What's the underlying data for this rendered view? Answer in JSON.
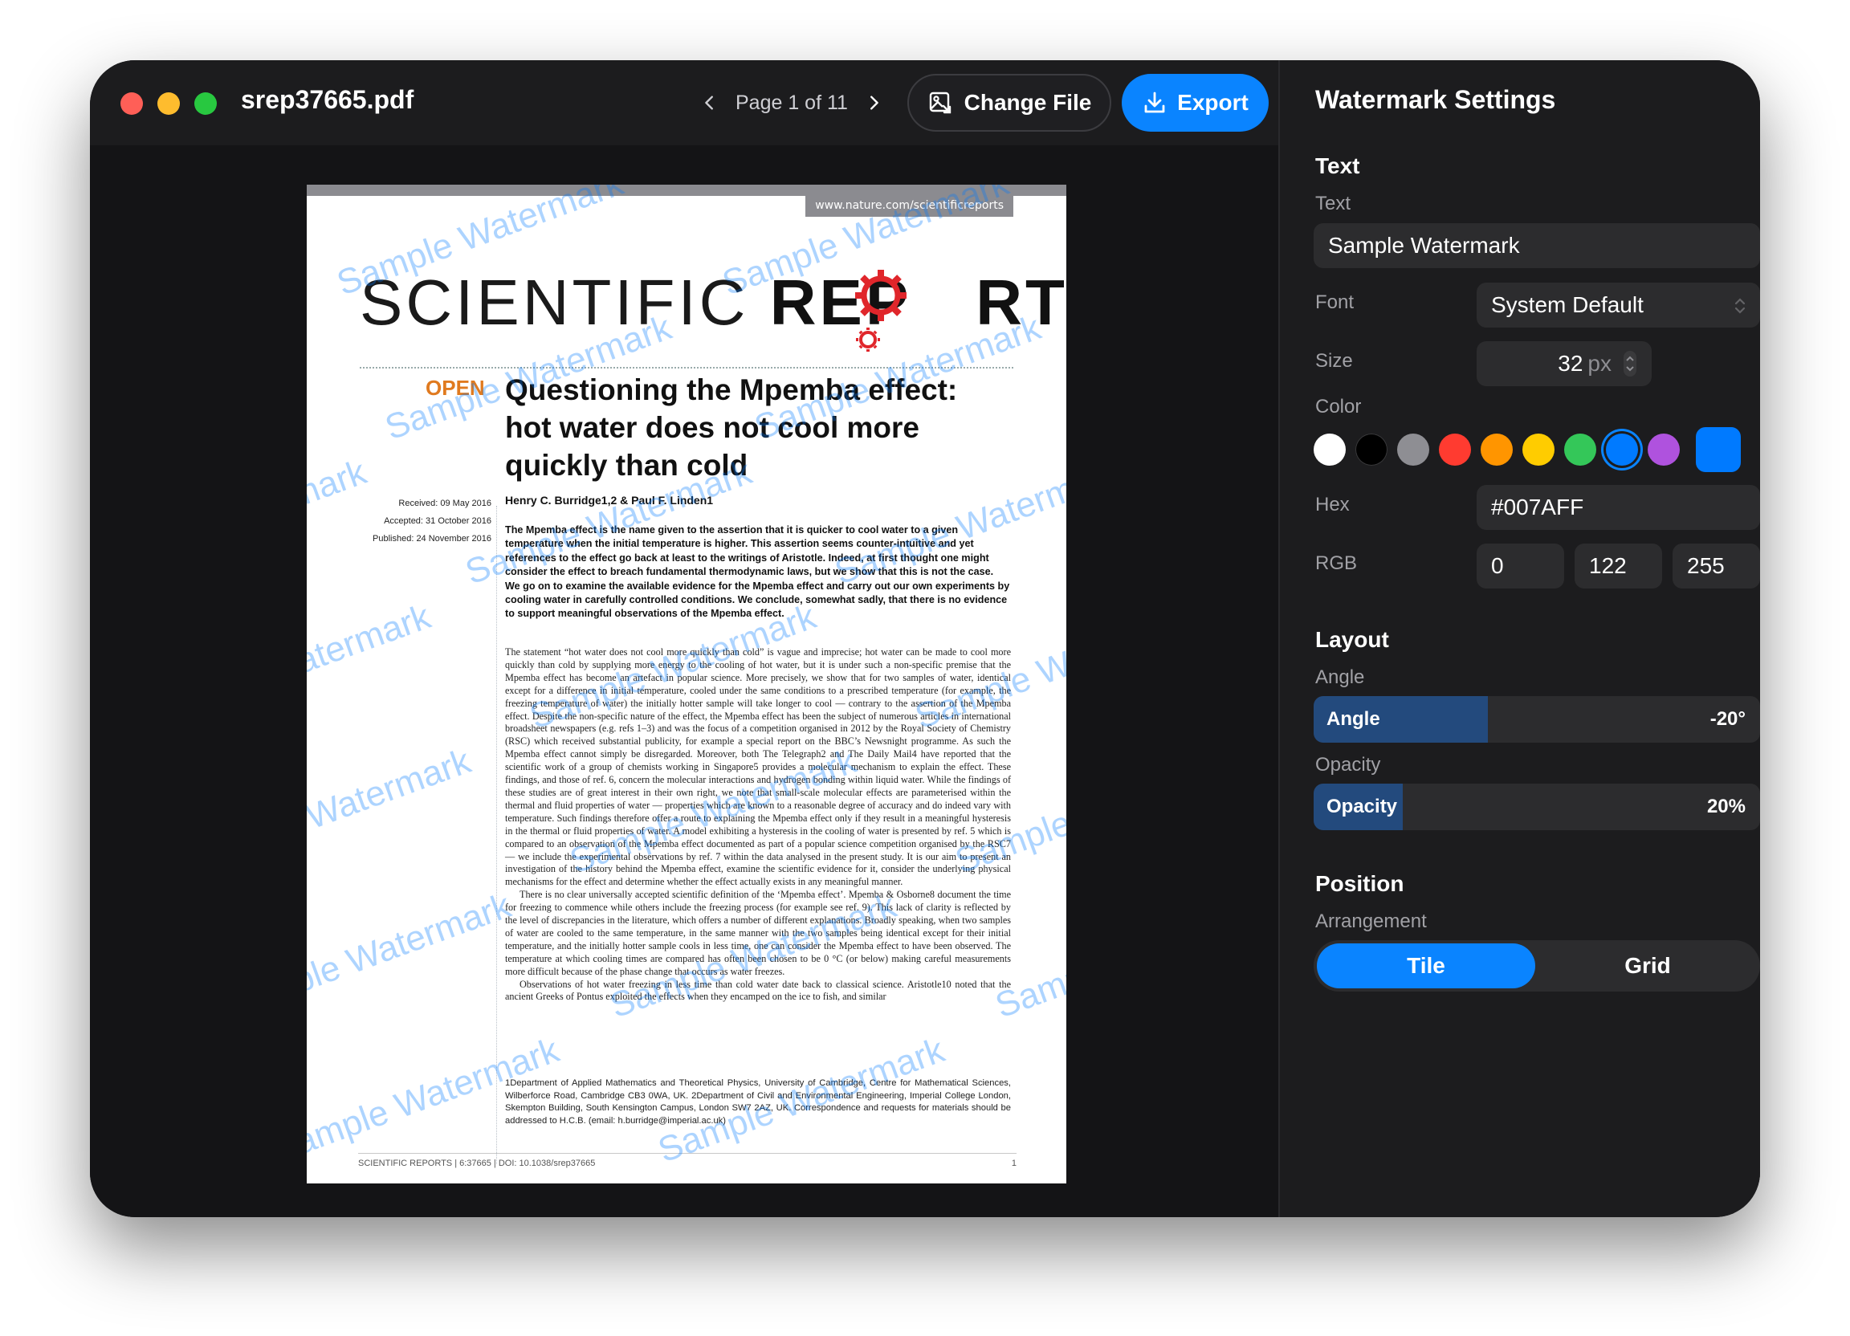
{
  "window": {
    "file_name": "srep37665.pdf",
    "page_label": "Page 1 of 11",
    "change_file_label": "Change File",
    "export_label": "Export"
  },
  "pdf": {
    "url_badge": "www.nature.com/scientificreports",
    "masthead_left": "SCIENTIFIC ",
    "masthead_right": "REP",
    "masthead_end": "RTS",
    "open_label": "OPEN",
    "title": "Questioning the Mpemba effect: hot water does not cool more quickly than cold",
    "received": "Received: 09 May 2016",
    "accepted": "Accepted: 31 October 2016",
    "published": "Published: 24 November 2016",
    "authors": "Henry C. Burridge1,2 & Paul F. Linden1",
    "abstract": "The Mpemba effect is the name given to the assertion that it is quicker to cool water to a given temperature when the initial temperature is higher. This assertion seems counter-intuitive and yet references to the effect go back at least to the writings of Aristotle. Indeed, at first thought one might consider the effect to breach fundamental thermodynamic laws, but we show that this is not the case. We go on to examine the available evidence for the Mpemba effect and carry out our own experiments by cooling water in carefully controlled conditions. We conclude, somewhat sadly, that there is no evidence to support meaningful observations of the Mpemba effect.",
    "body_p1": "The statement “hot water does not cool more quickly than cold” is vague and imprecise; hot water can be made to cool more quickly than cold by supplying more energy to the cooling of hot water, but it is under such a non-specific premise that the Mpemba effect has become an artefact in popular science. More precisely, we show that for two samples of water, identical except for a difference in initial temperature, cooled under the same conditions to a prescribed temperature (for example, the freezing temperature of water) the initially hotter sample will take longer to cool — contrary to the assertion of the Mpemba effect. Despite the non-specific nature of the effect, the Mpemba effect has been the subject of numerous articles in international broadsheet newspapers (e.g. refs 1–3) and was the focus of a competition organised in 2012 by the Royal Society of Chemistry (RSC) which received substantial publicity, for example a special report on the BBC’s Newsnight programme. As such the Mpemba effect cannot simply be disregarded. Moreover, both The Telegraph2 and The Daily Mail4 have reported that the scientific work of a group of chemists working in Singapore5 provides a molecular mechanism to explain the effect. These findings, and those of ref. 6, concern the molecular interactions and hydrogen bonding within liquid water. While the findings of these studies are of great interest in their own right, we note that small-scale molecular effects are parameterised within the thermal and fluid properties of water — properties which are known to a reasonable degree of accuracy and do indeed vary with temperature. Such findings therefore offer a route to explaining the Mpemba effect only if they result in a meaningful hysteresis in the thermal or fluid properties of water. A model exhibiting a hysteresis in the cooling of water is presented by ref. 5 which is compared to an observation of the Mpemba effect documented as part of a popular science competition organised by the RSC7 — we include the experimental observations by ref. 7 within the data analysed in the present study. It is our aim to present an investigation of the history behind the Mpemba effect, examine the scientific evidence for it, consider the underlying physical mechanisms for the effect and determine whether the effect actually exists in any meaningful manner.",
    "body_p2": "There is no clear universally accepted scientific definition of the ‘Mpemba effect’. Mpemba & Osborne8 document the time for freezing to commence while others include the freezing process (for example see ref. 9). This lack of clarity is reflected by the level of discrepancies in the literature, which offers a number of different explanations. Broadly speaking, when two samples of water are cooled to the same temperature, in the same manner with the two samples being identical except for their initial temperature, and the initially hotter sample cools in less time, one can consider the Mpemba effect to have been observed. The temperature at which cooling times are compared has often been chosen to be 0 °C (or below) making careful measurements more difficult because of the phase change that occurs as water freezes.",
    "body_p3": "Observations of hot water freezing in less time than cold water date back to classical science. Aristotle10 noted that the ancient Greeks of Pontus exploited the effects when they encamped on the ice to fish, and similar",
    "footnote": "1Department of Applied Mathematics and Theoretical Physics, University of Cambridge, Centre for Mathematical Sciences, Wilberforce Road, Cambridge CB3 0WA, UK. 2Department of Civil and Environmental Engineering, Imperial College London, Skempton Building, South Kensington Campus, London SW7 2AZ, UK. Correspondence and requests for materials should be addressed to H.C.B. (email: h.burridge@imperial.ac.uk)",
    "footer_left": "SCIENTIFIC REPORTS | 6:37665 | DOI: 10.1038/srep37665",
    "footer_right": "1",
    "watermark_text": "Sample Watermark"
  },
  "sidebar": {
    "title": "Watermark Settings",
    "text_section": "Text",
    "text_label": "Text",
    "text_value": "Sample Watermark",
    "font_label": "Font",
    "font_value": "System Default",
    "size_label": "Size",
    "size_value": "32",
    "size_unit": "px",
    "color_label": "Color",
    "swatches": [
      {
        "name": "white",
        "hex": "#FFFFFF"
      },
      {
        "name": "black",
        "hex": "#000000"
      },
      {
        "name": "gray",
        "hex": "#8E8E93"
      },
      {
        "name": "red",
        "hex": "#FF3B30"
      },
      {
        "name": "orange",
        "hex": "#FF9500"
      },
      {
        "name": "yellow",
        "hex": "#FFCC00"
      },
      {
        "name": "green",
        "hex": "#34C759"
      },
      {
        "name": "blue",
        "hex": "#007AFF",
        "selected": true
      },
      {
        "name": "purple",
        "hex": "#AF52DE"
      }
    ],
    "custom_color": "#007AFF",
    "hex_label": "Hex",
    "hex_value": "#007AFF",
    "rgb_label": "RGB",
    "rgb_r": "0",
    "rgb_g": "122",
    "rgb_b": "255",
    "layout_section": "Layout",
    "angle_label": "Angle",
    "angle_slider_name": "Angle",
    "angle_value": "-20°",
    "angle_fraction": 0.39,
    "opacity_label": "Opacity",
    "opacity_slider_name": "Opacity",
    "opacity_value": "20%",
    "opacity_fraction": 0.2,
    "position_section": "Position",
    "arrangement_label": "Arrangement",
    "arrangement_options": [
      "Tile",
      "Grid"
    ],
    "arrangement_selected": "Tile"
  },
  "colors": {
    "accent": "#0A84FF",
    "window_bg": "#141416",
    "sidebar_bg": "#1C1C1E",
    "field_bg": "#2C2C2E",
    "open_orange": "#E07A1F",
    "gear_red": "#E0262B"
  },
  "icons": {
    "prev_page": "chevron-left-icon",
    "next_page": "chevron-right-icon",
    "change_file": "image-file-icon",
    "export": "download-icon",
    "font_select": "select-arrows-icon",
    "size_stepper": "stepper-icon",
    "fab": "command-icon"
  }
}
